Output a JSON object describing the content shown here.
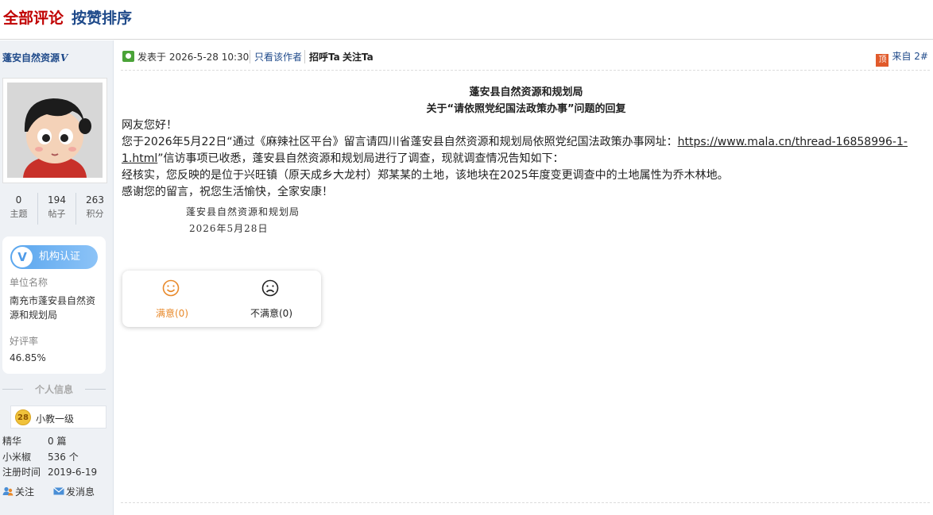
{
  "tabs": {
    "all_comments": "全部评论",
    "sort_by_likes": "按赞排序"
  },
  "sidebar": {
    "username": "蓬安自然资源",
    "verified_mark": "V",
    "stats": [
      {
        "value": "0",
        "label": "主题"
      },
      {
        "value": "194",
        "label": "帖子"
      },
      {
        "value": "263",
        "label": "积分"
      }
    ],
    "cert": {
      "badge_icon": "V",
      "badge_label": "机构认证",
      "unit_label": "单位名称",
      "unit_value": "南充市蓬安县自然资源和规划局",
      "rate_label": "好评率",
      "rate_value": "46.85%"
    },
    "personal_info_title": "个人信息",
    "level": {
      "number": "28",
      "name": "小教一级"
    },
    "info": [
      {
        "key": "精华",
        "value": "0 篇"
      },
      {
        "key": "小米椒",
        "value": "536 个"
      },
      {
        "key": "注册时间",
        "value": "2019-6-19"
      }
    ],
    "actions": {
      "follow": "关注",
      "message": "发消息"
    }
  },
  "post": {
    "posted_at": "发表于 2026-5-28 10:30",
    "only_author": "只看该作者",
    "greet": "招呼Ta",
    "follow": "关注Ta",
    "floor_icon": "顶",
    "floor": "来自 2#",
    "title_line1": "蓬安县自然资源和规划局",
    "title_line2": "关于“请依照党纪国法政策办事”问题的回复",
    "greeting": "网友您好！",
    "body_p1_a": "您于2026年5月22日“通过《麻辣社区平台》留言请四川省蓬安县自然资源和规划局依照党纪国法政策办事网址：",
    "body_link_a": "https://www.mala.cn/thread-16858996-1-",
    "body_link_b": "1.html",
    "body_p1_b": "”信访事项已收悉，蓬安县自然资源和规划局进行了调查，现就调查情况告知如下：",
    "body_p2": "经核实，您反映的是位于兴旺镇（原天成乡大龙村）郑某某的土地，该地块在2025年度变更调查中的土地属性为乔木林地。",
    "body_p3": "感谢您的留言，祝您生活愉快，全家安康！",
    "signature": "蓬安县自然资源和规划局",
    "sign_date": "2026年5月28日",
    "votes": {
      "satisfied": "满意(0)",
      "unsatisfied": "不满意(0)",
      "satisfied_color": "#e8892a"
    }
  }
}
